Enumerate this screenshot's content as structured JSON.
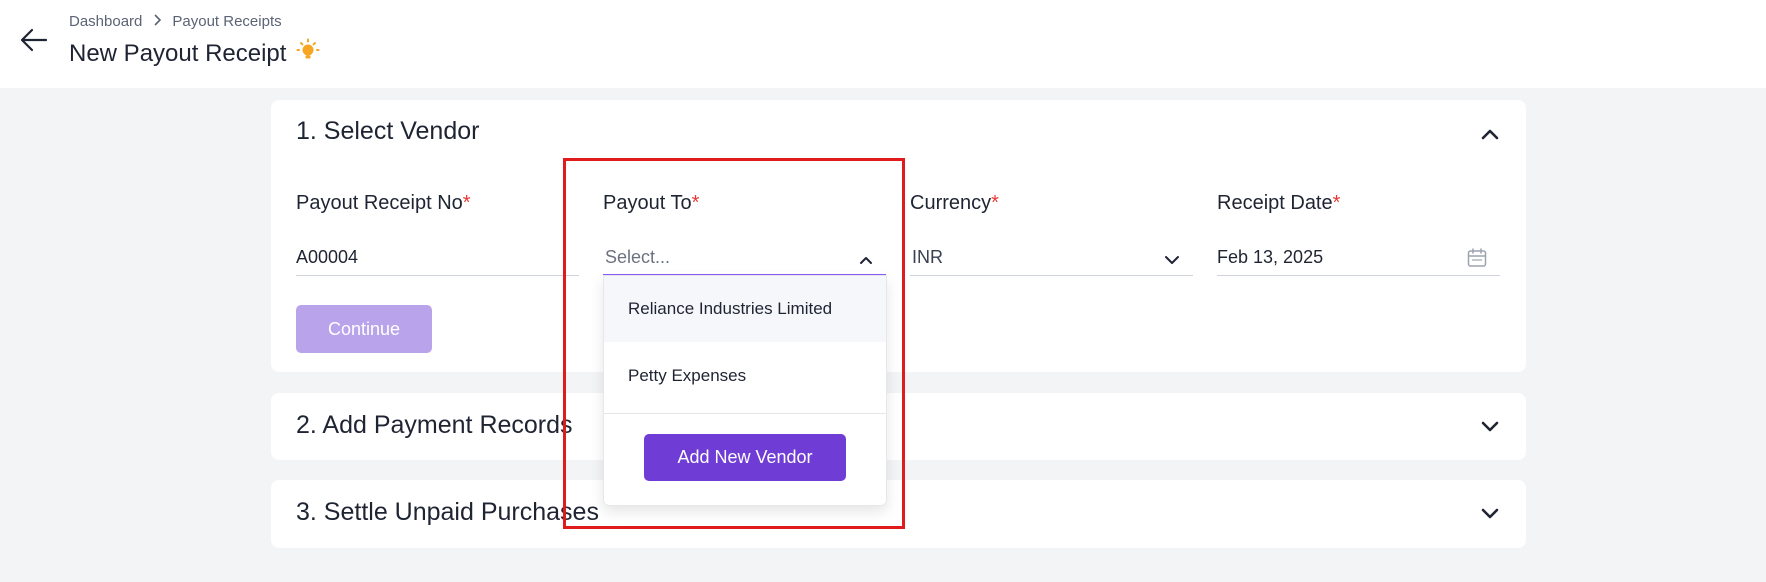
{
  "breadcrumb": {
    "dashboard": "Dashboard",
    "current": "Payout Receipts"
  },
  "header": {
    "title": "New Payout Receipt"
  },
  "section1": {
    "title": "1. Select Vendor",
    "fields": {
      "receipt_no": {
        "label": "Payout Receipt No",
        "value": "A00004"
      },
      "payout_to": {
        "label": "Payout To",
        "placeholder": "Select..."
      },
      "currency": {
        "label": "Currency",
        "value": "INR"
      },
      "receipt_date": {
        "label": "Receipt Date",
        "value": "Feb 13, 2025"
      }
    },
    "required_mark": "*",
    "continue_label": "Continue"
  },
  "dropdown": {
    "options": [
      "Reliance Industries Limited",
      "Petty Expenses"
    ],
    "add_label": "Add New Vendor"
  },
  "section2": {
    "title": "2. Add Payment Records"
  },
  "section3": {
    "title": "3. Settle Unpaid Purchases"
  },
  "colors": {
    "accent": "#6f3cd6",
    "accent_disabled": "#b9a4ec",
    "required": "#e53935",
    "highlight": "#e01b1b",
    "bulb": "#f5a623"
  }
}
